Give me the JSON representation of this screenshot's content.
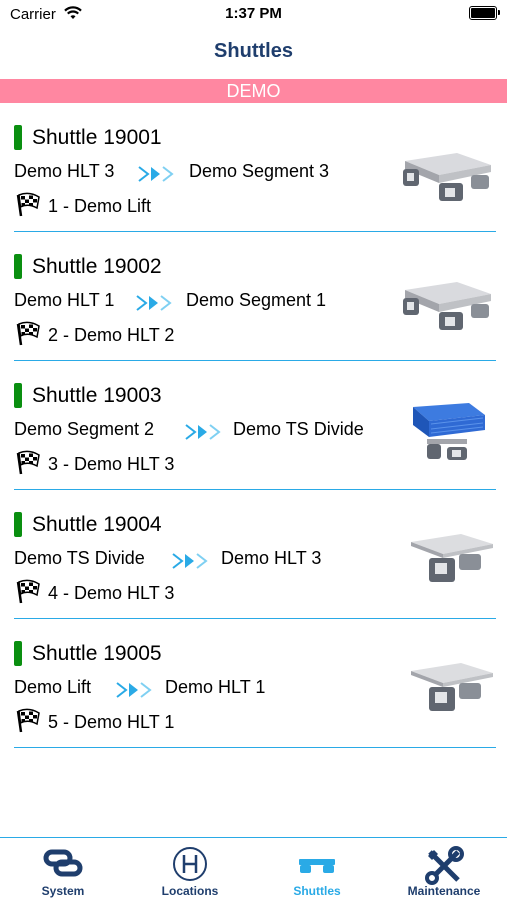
{
  "status_bar": {
    "carrier": "Carrier",
    "time": "1:37 PM"
  },
  "nav": {
    "title": "Shuttles"
  },
  "section": {
    "header": "DEMO"
  },
  "shuttles": [
    {
      "name": "Shuttle 19001",
      "from": "Demo HLT 3",
      "to": "Demo Segment 3",
      "target": "1 - Demo Lift",
      "image": "shuttle-empty",
      "status_color": "#0a8f10"
    },
    {
      "name": "Shuttle 19002",
      "from": "Demo HLT 1",
      "to": "Demo Segment 1",
      "target": "2 - Demo HLT 2",
      "image": "shuttle-empty",
      "status_color": "#0a8f10"
    },
    {
      "name": "Shuttle 19003",
      "from": "Demo Segment 2",
      "to": "Demo TS Divide",
      "target": "3 - Demo HLT 3",
      "image": "shuttle-with-blue-crate",
      "status_color": "#0a8f10"
    },
    {
      "name": "Shuttle 19004",
      "from": "Demo TS Divide",
      "to": "Demo HLT 3",
      "target": "4 - Demo HLT 3",
      "image": "shuttle-with-plate",
      "status_color": "#0a8f10"
    },
    {
      "name": "Shuttle 19005",
      "from": "Demo Lift",
      "to": "Demo HLT 1",
      "target": "5 - Demo HLT 1",
      "image": "shuttle-with-plate",
      "status_color": "#0a8f10"
    }
  ],
  "tabs": [
    {
      "label": "System",
      "icon": "link-icon",
      "active": false
    },
    {
      "label": "Locations",
      "icon": "circled-h-icon",
      "active": false
    },
    {
      "label": "Shuttles",
      "icon": "shuttle-icon",
      "active": true
    },
    {
      "label": "Maintenance",
      "icon": "tools-icon",
      "active": false
    }
  ],
  "colors": {
    "nav_title": "#1f3e6d",
    "section_header_bg": "#ff87a1",
    "accent": "#2aaae6",
    "status_ok": "#0a8f10"
  }
}
